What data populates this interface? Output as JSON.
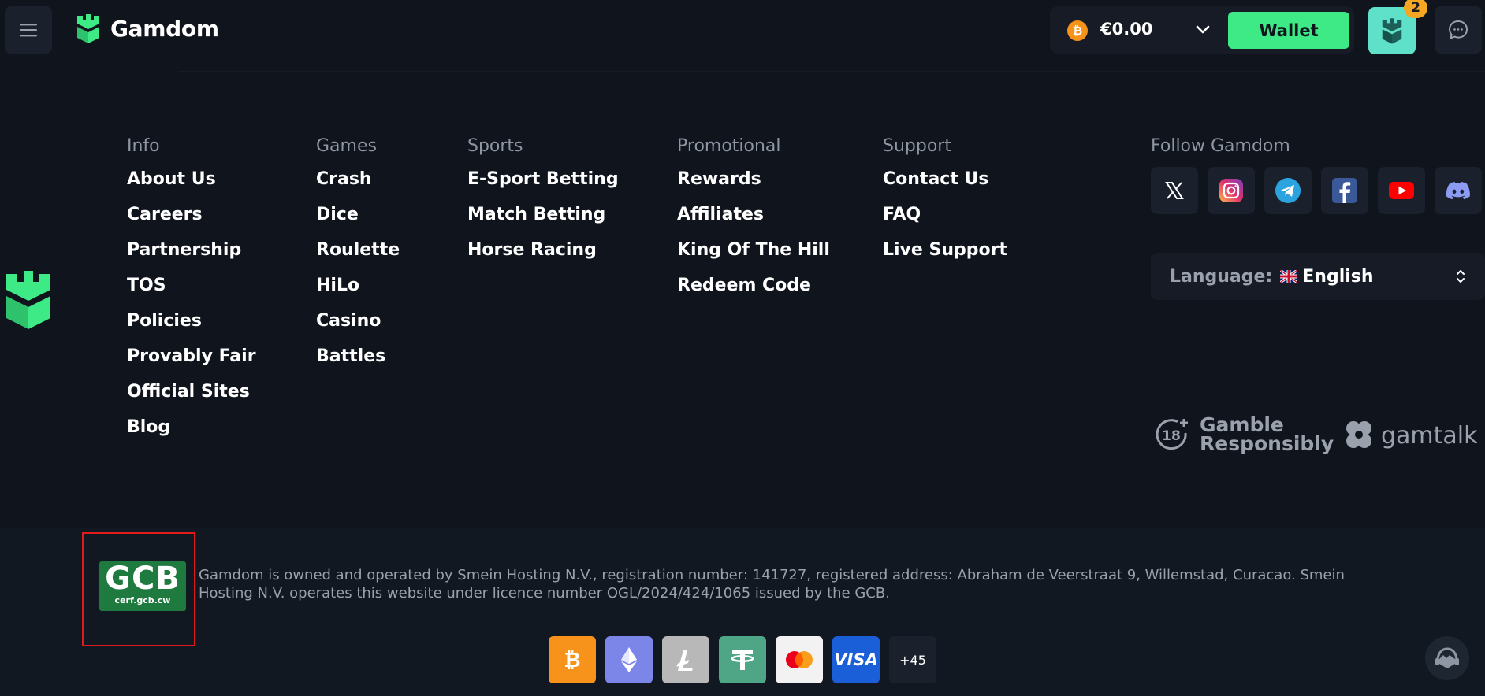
{
  "header": {
    "brand": "Gamdom",
    "balance": "€0.00",
    "wallet_label": "Wallet",
    "notification_count": "2"
  },
  "footer": {
    "columns": [
      {
        "title": "Info",
        "links": [
          "About Us",
          "Careers",
          "Partnership",
          "TOS",
          "Policies",
          "Provably Fair",
          "Official Sites",
          "Blog"
        ]
      },
      {
        "title": "Games",
        "links": [
          "Crash",
          "Dice",
          "Roulette",
          "HiLo",
          "Casino",
          "Battles"
        ]
      },
      {
        "title": "Sports",
        "links": [
          "E-Sport Betting",
          "Match Betting",
          "Horse Racing"
        ]
      },
      {
        "title": "Promotional",
        "links": [
          "Rewards",
          "Affiliates",
          "King Of The Hill",
          "Redeem Code"
        ]
      },
      {
        "title": "Support",
        "links": [
          "Contact Us",
          "FAQ",
          "Live Support"
        ]
      }
    ],
    "follow_title": "Follow Gamdom",
    "socials": [
      "x-icon",
      "instagram-icon",
      "telegram-icon",
      "facebook-icon",
      "youtube-icon",
      "discord-icon"
    ],
    "language_label": "Language:",
    "language_value": "English",
    "gamble_line1": "Gamble",
    "gamble_line2": "Responsibly",
    "gamble_age": "18",
    "gamtalk": "gamtalk"
  },
  "bottom": {
    "gcb_main": "GCB",
    "gcb_sub": "cerf.gcb.cw",
    "license_text": "Gamdom is owned and operated by Smein Hosting N.V., registration number: 141727, registered address: Abraham de Veerstraat 9, Willemstad, Curacao. Smein Hosting N.V. operates this website under licence number OGL/2024/424/1065 issued by the GCB.",
    "payments": [
      "bitcoin-icon",
      "ethereum-icon",
      "litecoin-icon",
      "tether-icon",
      "mastercard-icon",
      "visa-icon"
    ],
    "visa_label": "VISA",
    "more_methods": "+45"
  },
  "colors": {
    "background": "#0f141d",
    "accent": "#3dea86",
    "muted_text": "#8f96a3",
    "highlight_border": "#e01b1b"
  }
}
